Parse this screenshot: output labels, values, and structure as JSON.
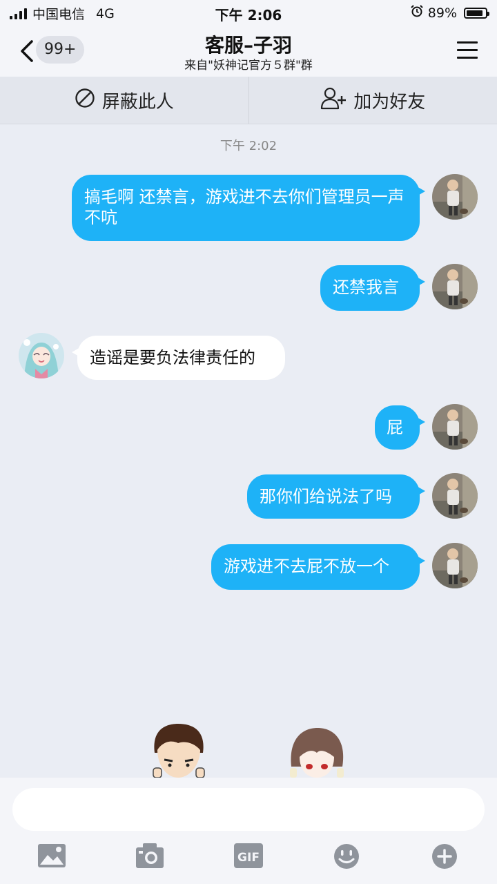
{
  "status_bar": {
    "carrier": "中国电信",
    "network": "4G",
    "time": "下午 2:06",
    "battery_percent": "89%",
    "battery_level": 0.89,
    "alarm_icon": "alarm-clock-icon"
  },
  "nav": {
    "back_icon": "chevron-left-icon",
    "unread_badge": "99+",
    "title": "客服–子羽",
    "subtitle": "来自\"妖神记官方５群\"群",
    "menu_icon": "hamburger-menu-icon"
  },
  "actions": {
    "block": {
      "label": "屏蔽此人",
      "icon": "block-icon"
    },
    "add_friend": {
      "label": "加为好友",
      "icon": "add-user-icon"
    }
  },
  "chat": {
    "timestamp": "下午 2:02",
    "messages": [
      {
        "direction": "out",
        "text": "搞毛啊  还禁言，游戏进不去你们管理员一声不吭"
      },
      {
        "direction": "out",
        "text": "还禁我言"
      },
      {
        "direction": "in",
        "text": "造谣是要负法律责任的"
      },
      {
        "direction": "out",
        "text": "屁"
      },
      {
        "direction": "out",
        "text": "那你们给说法了吗"
      },
      {
        "direction": "out",
        "text": "游戏进不去屁不放一个"
      }
    ]
  },
  "composer": {
    "placeholder": "",
    "tools": [
      "image-icon",
      "camera-icon",
      "gif-icon",
      "emoji-icon",
      "plus-icon"
    ]
  },
  "colors": {
    "accent": "#1eb2f7",
    "background": "#eaedf4",
    "bar": "#f4f5f9"
  }
}
